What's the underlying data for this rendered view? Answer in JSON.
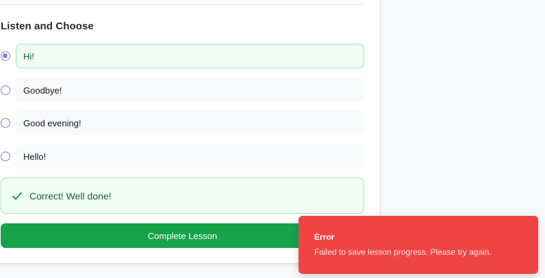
{
  "lesson": {
    "section_title": "Listen and Choose",
    "options": [
      {
        "label": "Hi!",
        "selected": true
      },
      {
        "label": "Goodbye!",
        "selected": false
      },
      {
        "label": "Good evening!",
        "selected": false
      },
      {
        "label": "Hello!",
        "selected": false
      }
    ],
    "feedback": {
      "icon": "check-icon",
      "message": "Correct! Well done!"
    },
    "complete_button": "Complete Lesson"
  },
  "toast": {
    "title": "Error",
    "message": "Failed to save lesson progress. Please try again."
  },
  "colors": {
    "success": "#16a34a",
    "success_bg": "#f0fdf4",
    "radio_accent": "#8b7fd6",
    "error": "#ef4444"
  }
}
